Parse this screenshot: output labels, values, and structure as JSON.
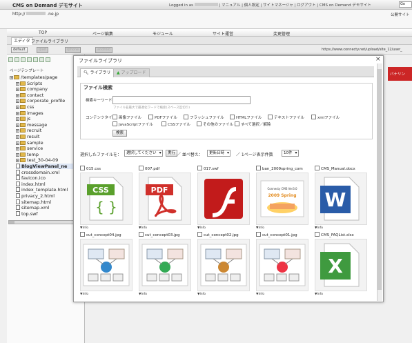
{
  "app": {
    "title": "CMS on Demand デモサイト"
  },
  "toplinks": {
    "logged_in": "Logged in as",
    "links": "| マニュアル | 個人設定 | サイトマネージャ | ログアウト |",
    "site": "CMS on Demand デモサイト",
    "select_value": "Go"
  },
  "urlbar": {
    "url": "http://",
    "domain": ".ne.jp",
    "publish": "公開サイト"
  },
  "nav": {
    "tabs": [
      "TOP",
      "ページ編集",
      "モジュール",
      "サイト運営",
      "変更管理"
    ]
  },
  "subtabs": [
    "エディタ",
    "ファイルライブラリ"
  ],
  "devices": {
    "buttons": [
      "default",
      "ipad",
      "iphone",
      "android"
    ],
    "base_url": "https://www.connecty.net/upload/site_12/user_"
  },
  "left": {
    "label": "ページテンプレート",
    "tree": [
      {
        "name": "/templates/page",
        "type": "folder",
        "depth": 0
      },
      {
        "name": "Scripts",
        "type": "folder",
        "depth": 1
      },
      {
        "name": "company",
        "type": "folder",
        "depth": 1
      },
      {
        "name": "contact",
        "type": "folder",
        "depth": 1
      },
      {
        "name": "corporate_profile",
        "type": "folder",
        "depth": 1
      },
      {
        "name": "css",
        "type": "folder",
        "depth": 1
      },
      {
        "name": "images",
        "type": "folder",
        "depth": 1
      },
      {
        "name": "js",
        "type": "folder",
        "depth": 1
      },
      {
        "name": "message",
        "type": "folder",
        "depth": 1
      },
      {
        "name": "recruit",
        "type": "folder",
        "depth": 1
      },
      {
        "name": "result",
        "type": "folder",
        "depth": 1
      },
      {
        "name": "sample",
        "type": "folder",
        "depth": 1
      },
      {
        "name": "service",
        "type": "folder",
        "depth": 1
      },
      {
        "name": "temp",
        "type": "folder",
        "depth": 1
      },
      {
        "name": "test_30-04-09",
        "type": "folder",
        "depth": 1
      },
      {
        "name": "BlogViewPanel_ne",
        "type": "file",
        "depth": 1,
        "bold": true
      },
      {
        "name": "crossdomain.xml",
        "type": "file",
        "depth": 1
      },
      {
        "name": "favicon.ico",
        "type": "file",
        "depth": 1
      },
      {
        "name": "index.html",
        "type": "file",
        "depth": 1
      },
      {
        "name": "index_template.html",
        "type": "file",
        "depth": 1
      },
      {
        "name": "privacy_2.html",
        "type": "file",
        "depth": 1
      },
      {
        "name": "sitemap.html",
        "type": "file",
        "depth": 1
      },
      {
        "name": "sitemap.xml",
        "type": "file",
        "depth": 1
      },
      {
        "name": "top.swf",
        "type": "file",
        "depth": 1
      }
    ]
  },
  "right_panel": {
    "label": "バナリン"
  },
  "modal": {
    "title": "ファイルライブラリ",
    "close": "×",
    "tabs": [
      "ライブラリ",
      "アップロード"
    ],
    "search": {
      "title": "ファイル検索",
      "keyword_label": "検索キーワード",
      "keyword_value": "",
      "keyword_hint": "ファイル名最大で最適化ワードで検索(スペース区切り)",
      "content_type_label": "コンテンツタイプ",
      "types_row1": [
        "画像ファイル",
        "PDFファイル",
        "フラッシュファイル",
        "HTMLファイル",
        "テキストファイル",
        "xmlファイル"
      ],
      "types_row2": [
        "JavaScriptファイル",
        "CSSファイル",
        "その他のファイル",
        "すべて選択／解除"
      ],
      "search_button": "検索"
    },
    "selection": {
      "label": "選択したファイルを：",
      "action_select": "選択してください",
      "run_button": "実行",
      "sort_label": "／ 並べ替え：",
      "sort_select": "更新日時",
      "per_page_label": "／ 1ページ表示件数",
      "per_page_select": "10件"
    },
    "files": [
      {
        "name": "015.css",
        "kind": "css",
        "info": "▼Info"
      },
      {
        "name": "007.pdf",
        "kind": "pdf",
        "info": "▼Info"
      },
      {
        "name": "017.swf",
        "kind": "swf",
        "info": "▼Info"
      },
      {
        "name": "ban_2009spring_com",
        "kind": "banner",
        "info": "▼Info"
      },
      {
        "name": "CMS_Manual.docx",
        "kind": "docx",
        "info": "▼Info"
      },
      {
        "name": "cut_concept04.jpg",
        "kind": "jpg",
        "info": "▼Info"
      },
      {
        "name": "cut_concept03.jpg",
        "kind": "jpg",
        "info": "▼Info"
      },
      {
        "name": "cut_concept02.jpg",
        "kind": "jpg",
        "info": "▼Info"
      },
      {
        "name": "cut_concept01.jpg",
        "kind": "jpg",
        "info": "▼Info"
      },
      {
        "name": "CMS_FAQList.xlsx",
        "kind": "xlsx",
        "info": "▼Info"
      }
    ]
  },
  "icon_labels": {
    "css": "CSS",
    "css_sub": "{ }",
    "pdf": "PDF",
    "banner": "Connecty CMS Ver3.0",
    "banner_sub": "2009 Spring",
    "word": "W",
    "excel": "X"
  },
  "colors": {
    "css": "#5aa02c",
    "pdf": "#d0302b",
    "swf": "#c21b1b",
    "word": "#2a5ca8",
    "excel": "#3f9a3f",
    "header_red": "#cc2626"
  }
}
